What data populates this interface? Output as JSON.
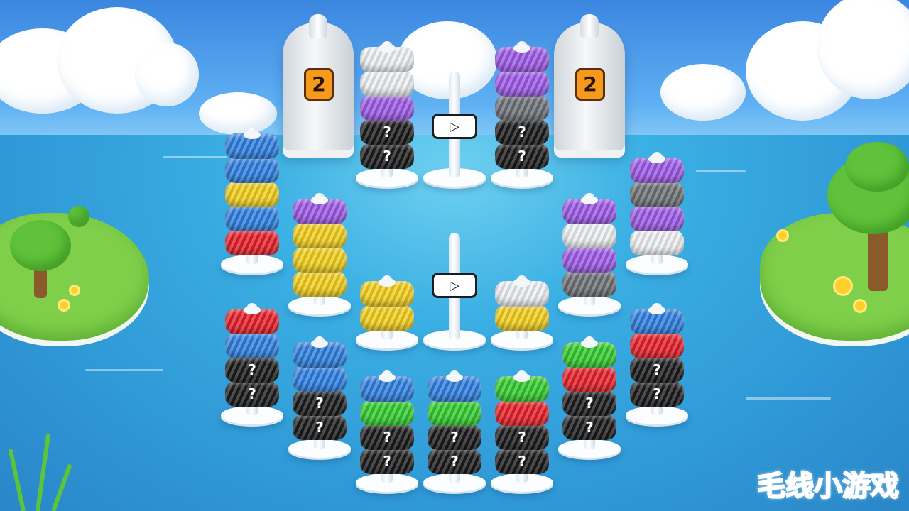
{
  "colors": {
    "blue": "#2f7fe0",
    "yellow": "#f2cf1d",
    "red": "#e5202a",
    "purple": "#9d5ae6",
    "white": "#eef1f4",
    "gray": "#6d7176",
    "black": "#1b1b1d",
    "green": "#33cc2f"
  },
  "hidden_mark": "?",
  "locked_rods": [
    {
      "id": "left",
      "cost": "2",
      "icon": "ghost-sheet-icon"
    },
    {
      "id": "right",
      "cost": "2",
      "icon": "ghost-sheet-icon"
    }
  ],
  "ad_buttons": [
    {
      "id": "top",
      "label": "▷",
      "icon": "play-video-icon"
    },
    {
      "id": "middle",
      "label": "▷",
      "icon": "play-video-icon"
    }
  ],
  "rods": [
    {
      "id": "t1",
      "rings": [
        "white",
        "white",
        "purple",
        "black?",
        "black?"
      ]
    },
    {
      "id": "t2",
      "rings": [
        "purple",
        "purple",
        "gray",
        "black?",
        "black?"
      ]
    },
    {
      "id": "t-empty",
      "rings": []
    },
    {
      "id": "c1",
      "rings": [
        "blue",
        "blue",
        "yellow",
        "blue",
        "red"
      ]
    },
    {
      "id": "c2",
      "rings": [
        "purple",
        "yellow",
        "yellow",
        "yellow"
      ]
    },
    {
      "id": "c3",
      "rings": [
        "yellow",
        "yellow"
      ]
    },
    {
      "id": "c-empty",
      "rings": []
    },
    {
      "id": "c4",
      "rings": [
        "white",
        "yellow"
      ]
    },
    {
      "id": "c5",
      "rings": [
        "purple",
        "white",
        "purple",
        "gray"
      ]
    },
    {
      "id": "c6",
      "rings": [
        "purple",
        "gray",
        "purple",
        "white"
      ]
    },
    {
      "id": "b1",
      "rings": [
        "red",
        "blue",
        "black?",
        "black?"
      ]
    },
    {
      "id": "b2",
      "rings": [
        "blue",
        "blue",
        "black?",
        "black?"
      ]
    },
    {
      "id": "b3",
      "rings": [
        "blue",
        "green",
        "black?",
        "black?"
      ]
    },
    {
      "id": "b4",
      "rings": [
        "blue",
        "green",
        "black?",
        "black?"
      ]
    },
    {
      "id": "b5",
      "rings": [
        "green",
        "red",
        "black?",
        "black?"
      ]
    },
    {
      "id": "b6",
      "rings": [
        "green",
        "red",
        "black?",
        "black?"
      ]
    },
    {
      "id": "b7",
      "rings": [
        "blue",
        "red",
        "black?",
        "black?"
      ]
    }
  ],
  "watermark": "毛线小游戏"
}
